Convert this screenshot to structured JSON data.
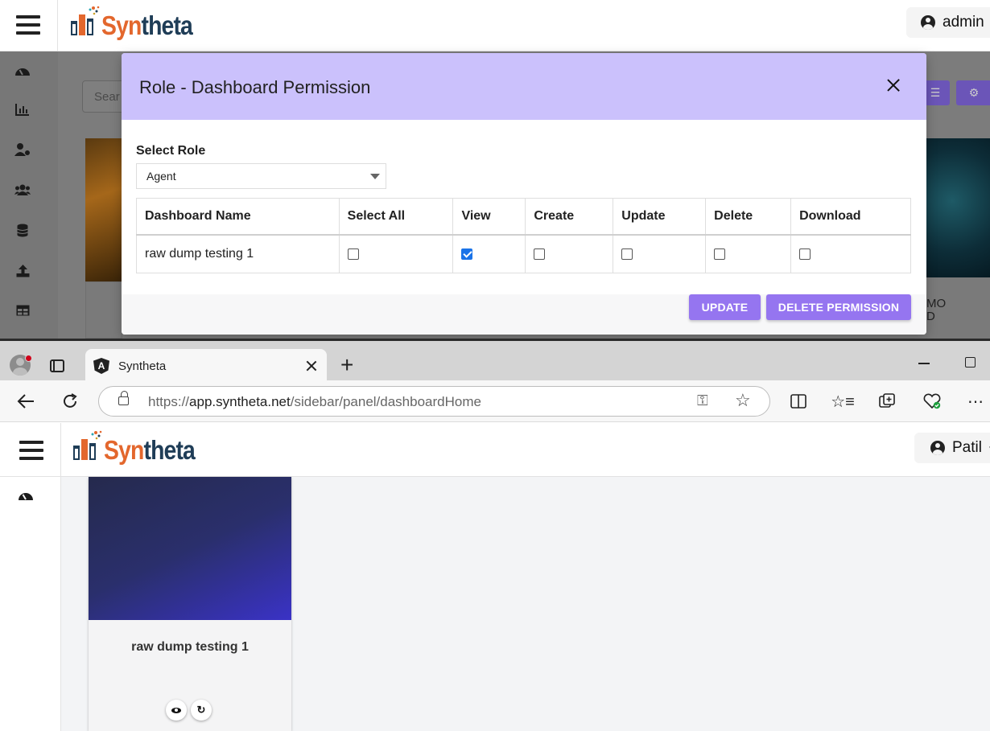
{
  "app_top": {
    "logo": {
      "part1": "Syn",
      "part2": "theta"
    },
    "user": "admin",
    "search_placeholder": "Sear",
    "bg_card_text": "MO\nD",
    "sidebar_icons": [
      "dashboard-icon",
      "chart-icon",
      "user-settings-icon",
      "users-icon",
      "database-icon",
      "upload-icon",
      "table-icon"
    ]
  },
  "modal": {
    "title": "Role - Dashboard Permission",
    "select_label": "Select Role",
    "selected_role": "Agent",
    "columns": [
      "Dashboard Name",
      "Select All",
      "View",
      "Create",
      "Update",
      "Delete",
      "Download"
    ],
    "rows": [
      {
        "name": "raw dump testing 1",
        "select_all": false,
        "view": true,
        "create": false,
        "update": false,
        "delete": false,
        "download": false
      }
    ],
    "update_label": "UPDATE",
    "delete_label": "DELETE PERMISSION"
  },
  "browser": {
    "tab_title": "Syntheta",
    "url_prefix": "https://",
    "url_domain": "app.syntheta.net",
    "url_path": "/sidebar/panel/dashboardHome"
  },
  "app_bottom": {
    "logo": {
      "part1": "Syn",
      "part2": "theta"
    },
    "user": "Patil",
    "card_title": "raw dump testing 1"
  },
  "colors": {
    "modal_header": "#cbc1fc",
    "accent_button": "#9575f0",
    "checkbox_checked": "#1a73e8",
    "logo_orange": "#e3672d",
    "logo_navy": "#1f3d57"
  }
}
